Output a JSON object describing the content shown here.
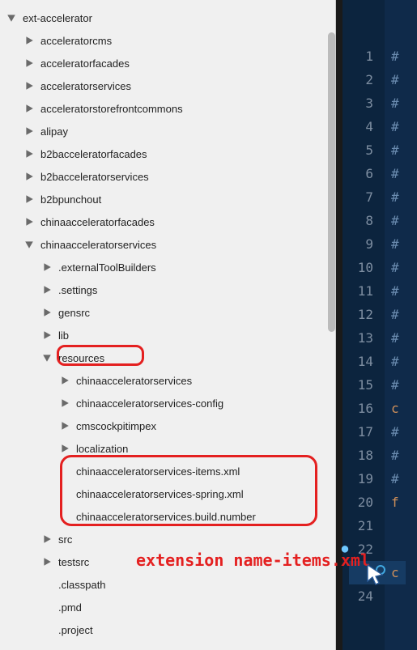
{
  "tree": {
    "root": "ext-accelerator",
    "items": [
      {
        "label": "acceleratorcms",
        "depth": 1,
        "tw": "closed"
      },
      {
        "label": "acceleratorfacades",
        "depth": 1,
        "tw": "closed"
      },
      {
        "label": "acceleratorservices",
        "depth": 1,
        "tw": "closed"
      },
      {
        "label": "acceleratorstorefrontcommons",
        "depth": 1,
        "tw": "closed"
      },
      {
        "label": "alipay",
        "depth": 1,
        "tw": "closed"
      },
      {
        "label": "b2bacceleratorfacades",
        "depth": 1,
        "tw": "closed"
      },
      {
        "label": "b2bacceleratorservices",
        "depth": 1,
        "tw": "closed"
      },
      {
        "label": "b2bpunchout",
        "depth": 1,
        "tw": "closed"
      },
      {
        "label": "chinaacceleratorfacades",
        "depth": 1,
        "tw": "closed"
      },
      {
        "label": "chinaacceleratorservices",
        "depth": 1,
        "tw": "open"
      },
      {
        "label": ".externalToolBuilders",
        "depth": 2,
        "tw": "closed"
      },
      {
        "label": ".settings",
        "depth": 2,
        "tw": "closed"
      },
      {
        "label": "gensrc",
        "depth": 2,
        "tw": "closed"
      },
      {
        "label": "lib",
        "depth": 2,
        "tw": "closed"
      },
      {
        "label": "resources",
        "depth": 2,
        "tw": "open"
      },
      {
        "label": "chinaacceleratorservices",
        "depth": 3,
        "tw": "closed"
      },
      {
        "label": "chinaacceleratorservices-config",
        "depth": 3,
        "tw": "closed"
      },
      {
        "label": "cmscockpitimpex",
        "depth": 3,
        "tw": "closed"
      },
      {
        "label": "localization",
        "depth": 3,
        "tw": "closed"
      },
      {
        "label": "chinaacceleratorservices-items.xml",
        "depth": 3,
        "tw": "none"
      },
      {
        "label": "chinaacceleratorservices-spring.xml",
        "depth": 3,
        "tw": "none"
      },
      {
        "label": "chinaacceleratorservices.build.number",
        "depth": 3,
        "tw": "none"
      },
      {
        "label": "src",
        "depth": 2,
        "tw": "closed"
      },
      {
        "label": "testsrc",
        "depth": 2,
        "tw": "closed"
      },
      {
        "label": ".classpath",
        "depth": 2,
        "tw": "none"
      },
      {
        "label": ".pmd",
        "depth": 2,
        "tw": "none"
      },
      {
        "label": ".project",
        "depth": 2,
        "tw": "none"
      }
    ]
  },
  "editor": {
    "lines": [
      "1",
      "2",
      "3",
      "4",
      "5",
      "6",
      "7",
      "8",
      "9",
      "10",
      "11",
      "12",
      "13",
      "14",
      "15",
      "16",
      "17",
      "18",
      "19",
      "20",
      "21",
      "22",
      "23",
      "24"
    ],
    "content": [
      "#",
      "#",
      "#",
      "#",
      "#",
      "#",
      "#",
      "#",
      "#",
      "#",
      "#",
      "#",
      "#",
      "#",
      "#",
      "c",
      "#",
      "#",
      "#",
      "f",
      "",
      "",
      "c",
      ""
    ]
  },
  "annotation": "extension name-items.xml"
}
